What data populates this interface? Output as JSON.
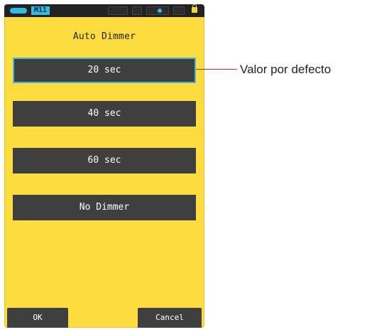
{
  "status_bar": {
    "memory_label": "M11",
    "icons": [
      "battery-icon",
      "memory-badge",
      "status-block",
      "status-block",
      "status-block-with-dot",
      "lock-icon"
    ]
  },
  "screen": {
    "title": "Auto Dimmer",
    "options": [
      {
        "label": "20 sec",
        "selected": true
      },
      {
        "label": "40 sec",
        "selected": false
      },
      {
        "label": "60 sec",
        "selected": false
      },
      {
        "label": "No Dimmer",
        "selected": false
      }
    ],
    "footer": {
      "ok_label": "OK",
      "cancel_label": "Cancel"
    }
  },
  "callout": {
    "text": "Valor por defecto"
  },
  "colors": {
    "screen_background": "#fddc3f",
    "button_background": "#3f3f3f",
    "selected_border": "#42b6dd",
    "callout_line": "#d9272b",
    "status_bar": "#222222",
    "accent_blue": "#33b9e6"
  }
}
